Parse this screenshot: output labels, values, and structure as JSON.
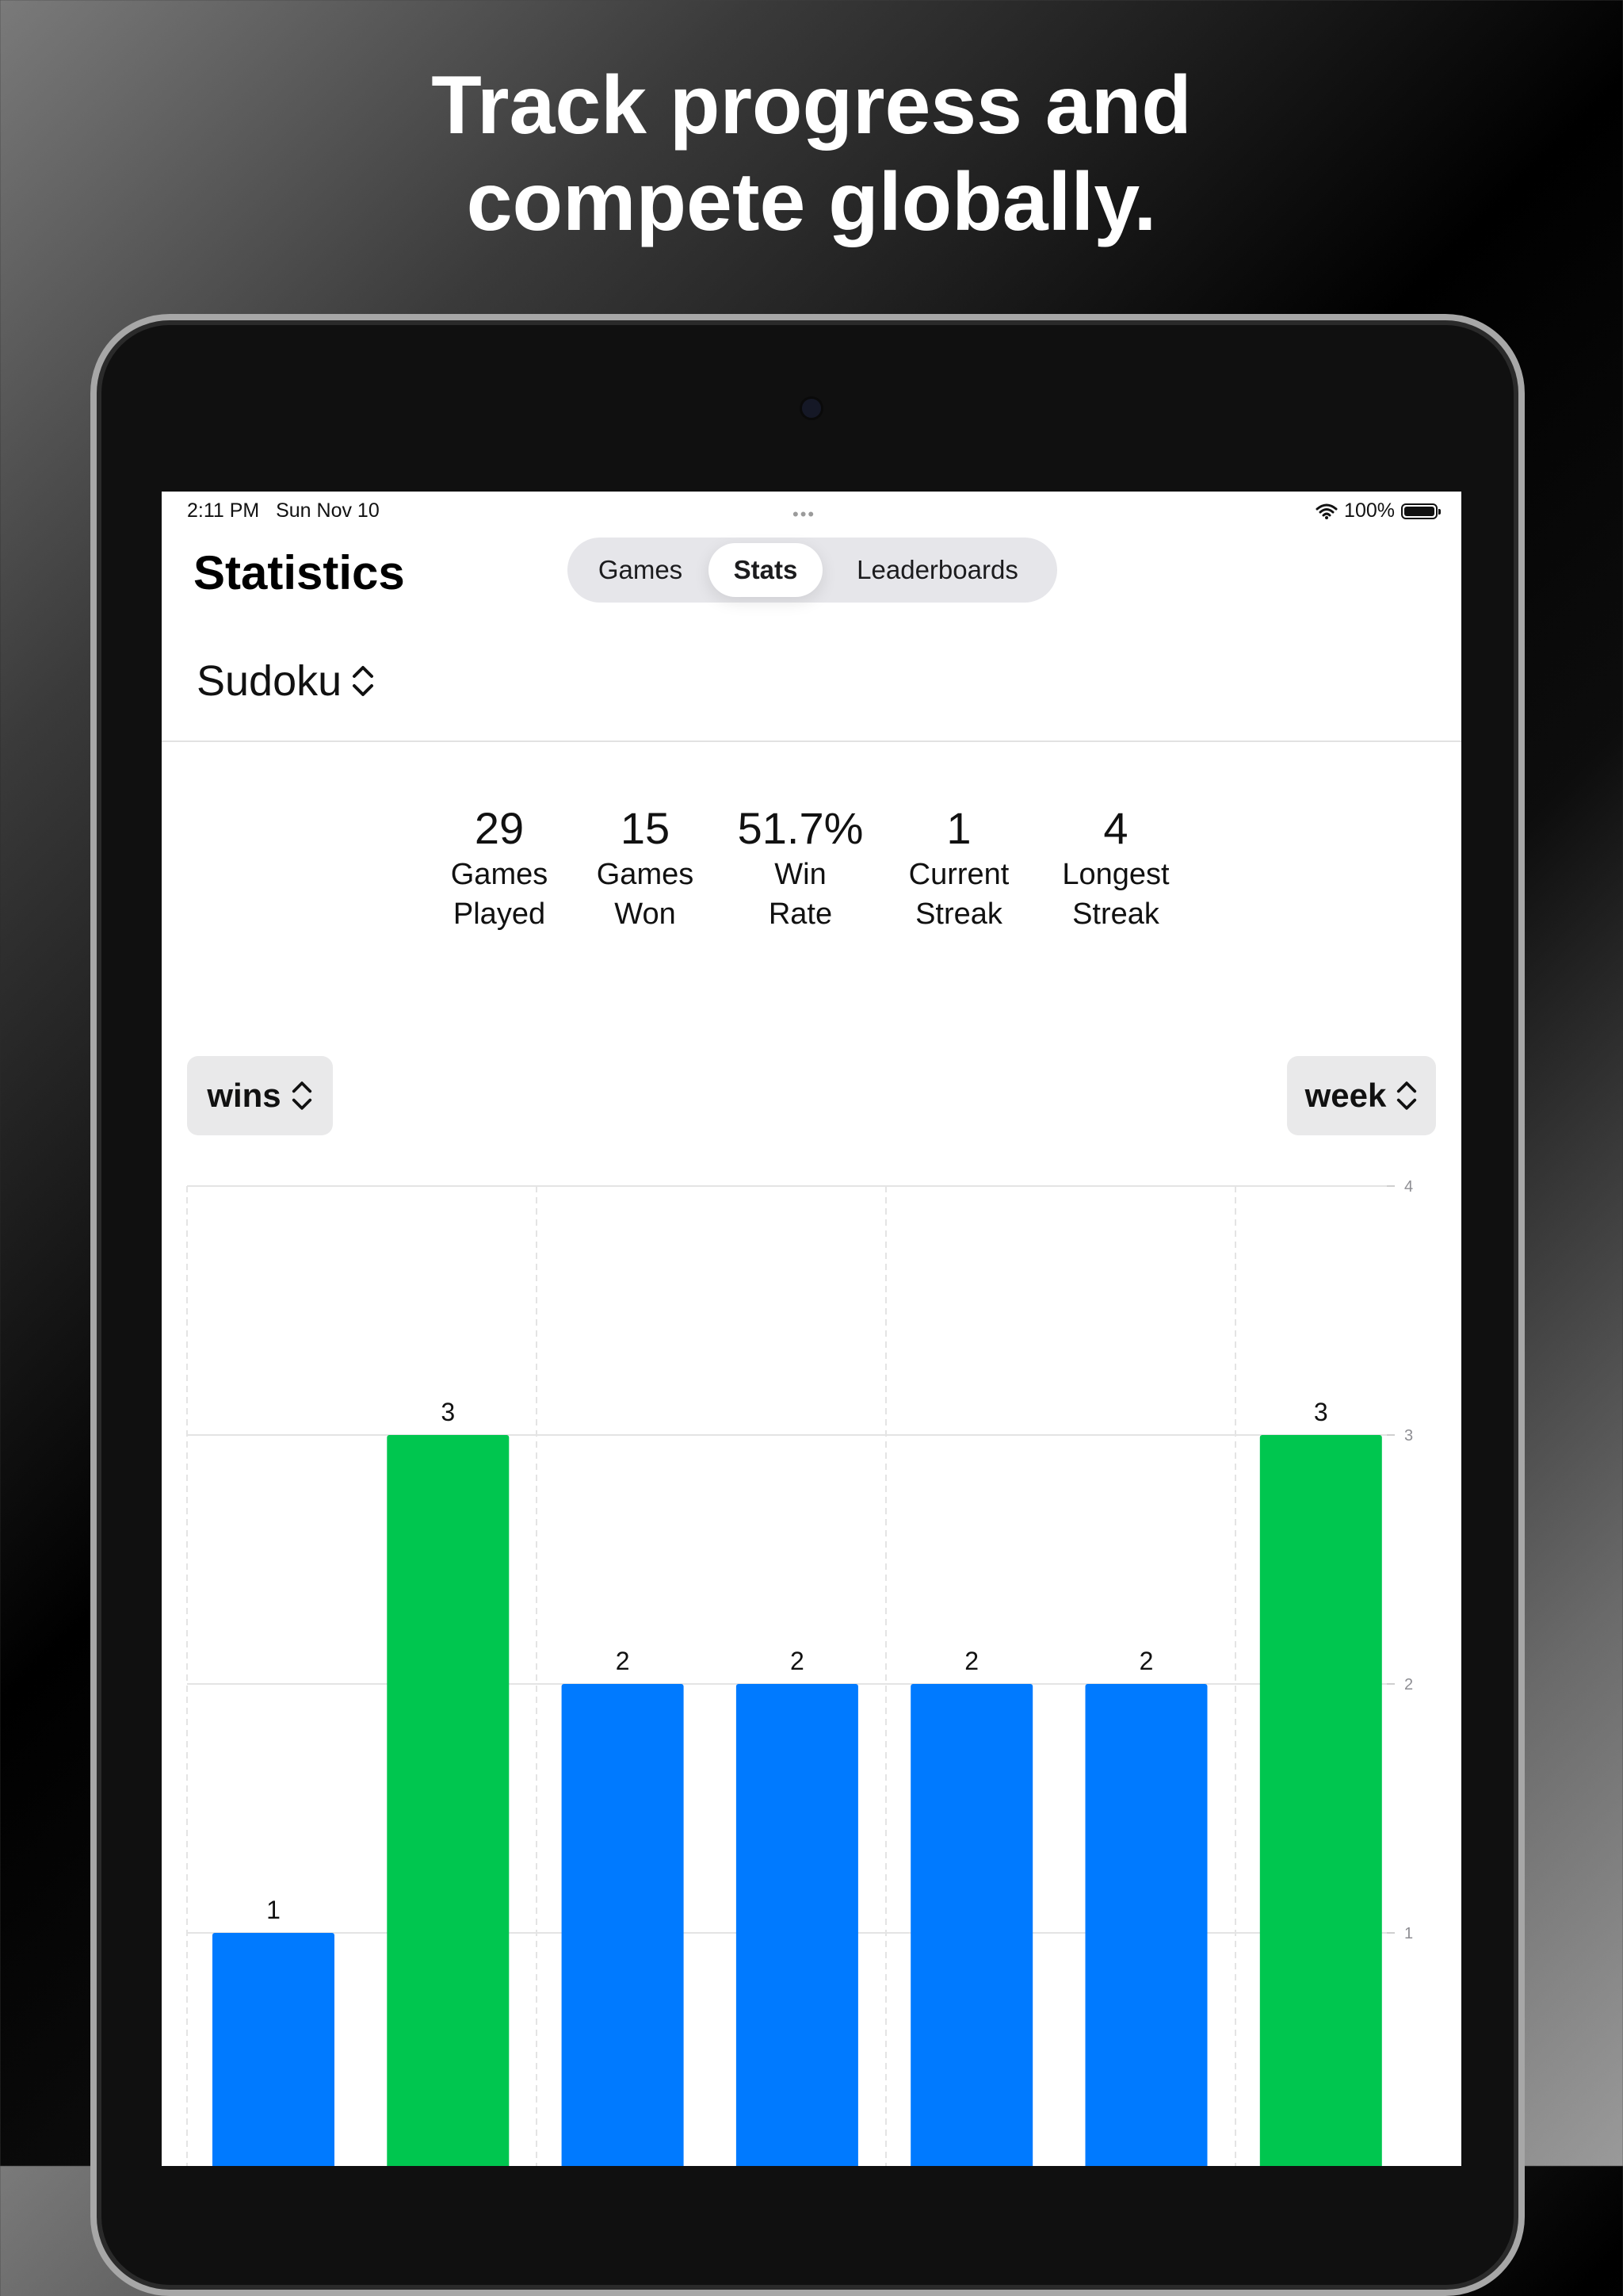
{
  "headline": {
    "line1": "Track progress and",
    "line2": "compete globally."
  },
  "status_bar": {
    "time": "2:11 PM",
    "date": "Sun Nov 10",
    "dots": "•••",
    "battery": "100%",
    "wifi_icon": "wifi-icon",
    "battery_icon": "battery-icon"
  },
  "nav": {
    "title": "Statistics",
    "tabs": [
      {
        "label": "Games",
        "selected": false
      },
      {
        "label": "Stats",
        "selected": true
      },
      {
        "label": "Leaderboards",
        "selected": false
      }
    ]
  },
  "game_picker": {
    "value": "Sudoku",
    "icon": "chevron-up-down-icon"
  },
  "stats": [
    {
      "value": "29",
      "label1": "Games",
      "label2": "Played"
    },
    {
      "value": "15",
      "label1": "Games",
      "label2": "Won"
    },
    {
      "value": "51.7%",
      "label1": "Win",
      "label2": "Rate"
    },
    {
      "value": "1",
      "label1": "Current",
      "label2": "Streak"
    },
    {
      "value": "4",
      "label1": "Longest",
      "label2": "Streak"
    }
  ],
  "metric_picker": {
    "value": "wins"
  },
  "period_picker": {
    "value": "week"
  },
  "colors": {
    "blue": "#007AFF",
    "green": "#00C64F",
    "grid": "#e4e4e4"
  },
  "chart_data": {
    "type": "bar",
    "values": [
      1,
      3,
      2,
      2,
      2,
      2,
      3
    ],
    "bar_colors": [
      "blue",
      "green",
      "blue",
      "blue",
      "blue",
      "blue",
      "green"
    ],
    "yticks": [
      "1",
      "2",
      "3",
      "4"
    ],
    "ylim": [
      0,
      4
    ],
    "grid": true
  }
}
